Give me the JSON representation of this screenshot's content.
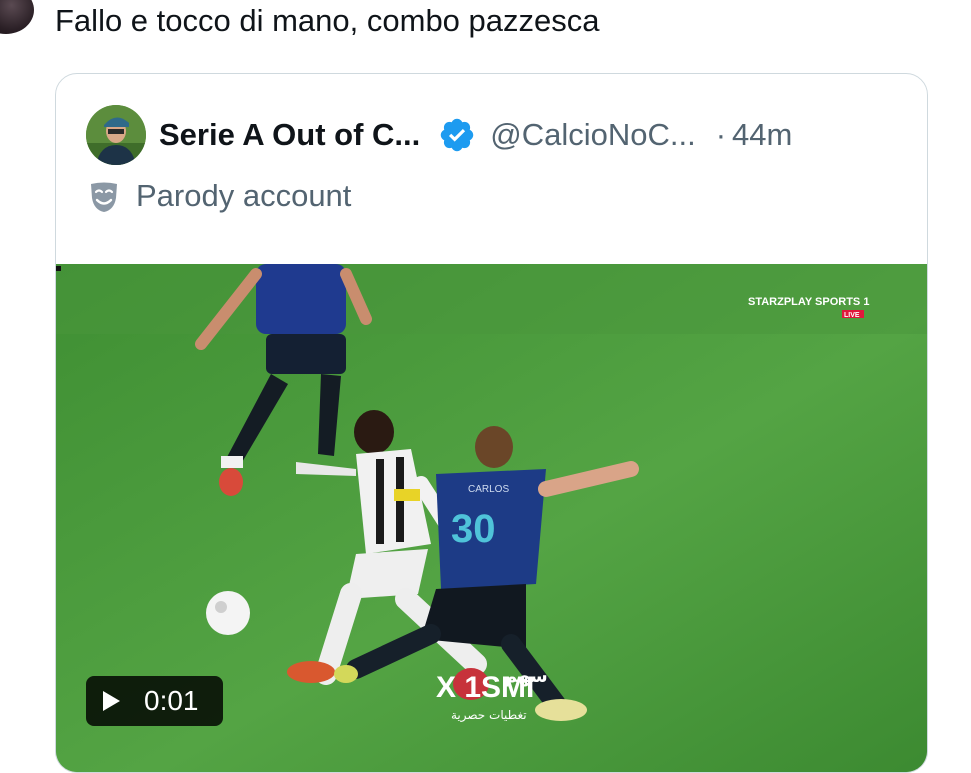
{
  "tweet": {
    "text": "Fallo e tocco di mano, combo pazzesca"
  },
  "quoted_tweet": {
    "display_name": "Serie A Out of C...",
    "handle": "@CalcioNoC...",
    "separator": "·",
    "time": "44m",
    "account_label": "Parody account",
    "video": {
      "duration": "0:01",
      "broadcaster_logo": "STARZPLAY SPORTS 1",
      "broadcaster_live": "LIVE",
      "player_number": "30",
      "player_name": "CARLOS",
      "watermark_brand": "X 1SMI",
      "watermark_arabic_top": "سهم",
      "watermark_arabic_sub": "تغطيات حصرية"
    }
  },
  "colors": {
    "verified": "#1d9bf0",
    "secondary_text": "#536471",
    "card_border": "#cfd9de",
    "pitch": "#4d9a3c"
  },
  "icons": {
    "verified": "verified-badge-icon",
    "parody": "theater-mask-icon",
    "play": "play-icon"
  }
}
